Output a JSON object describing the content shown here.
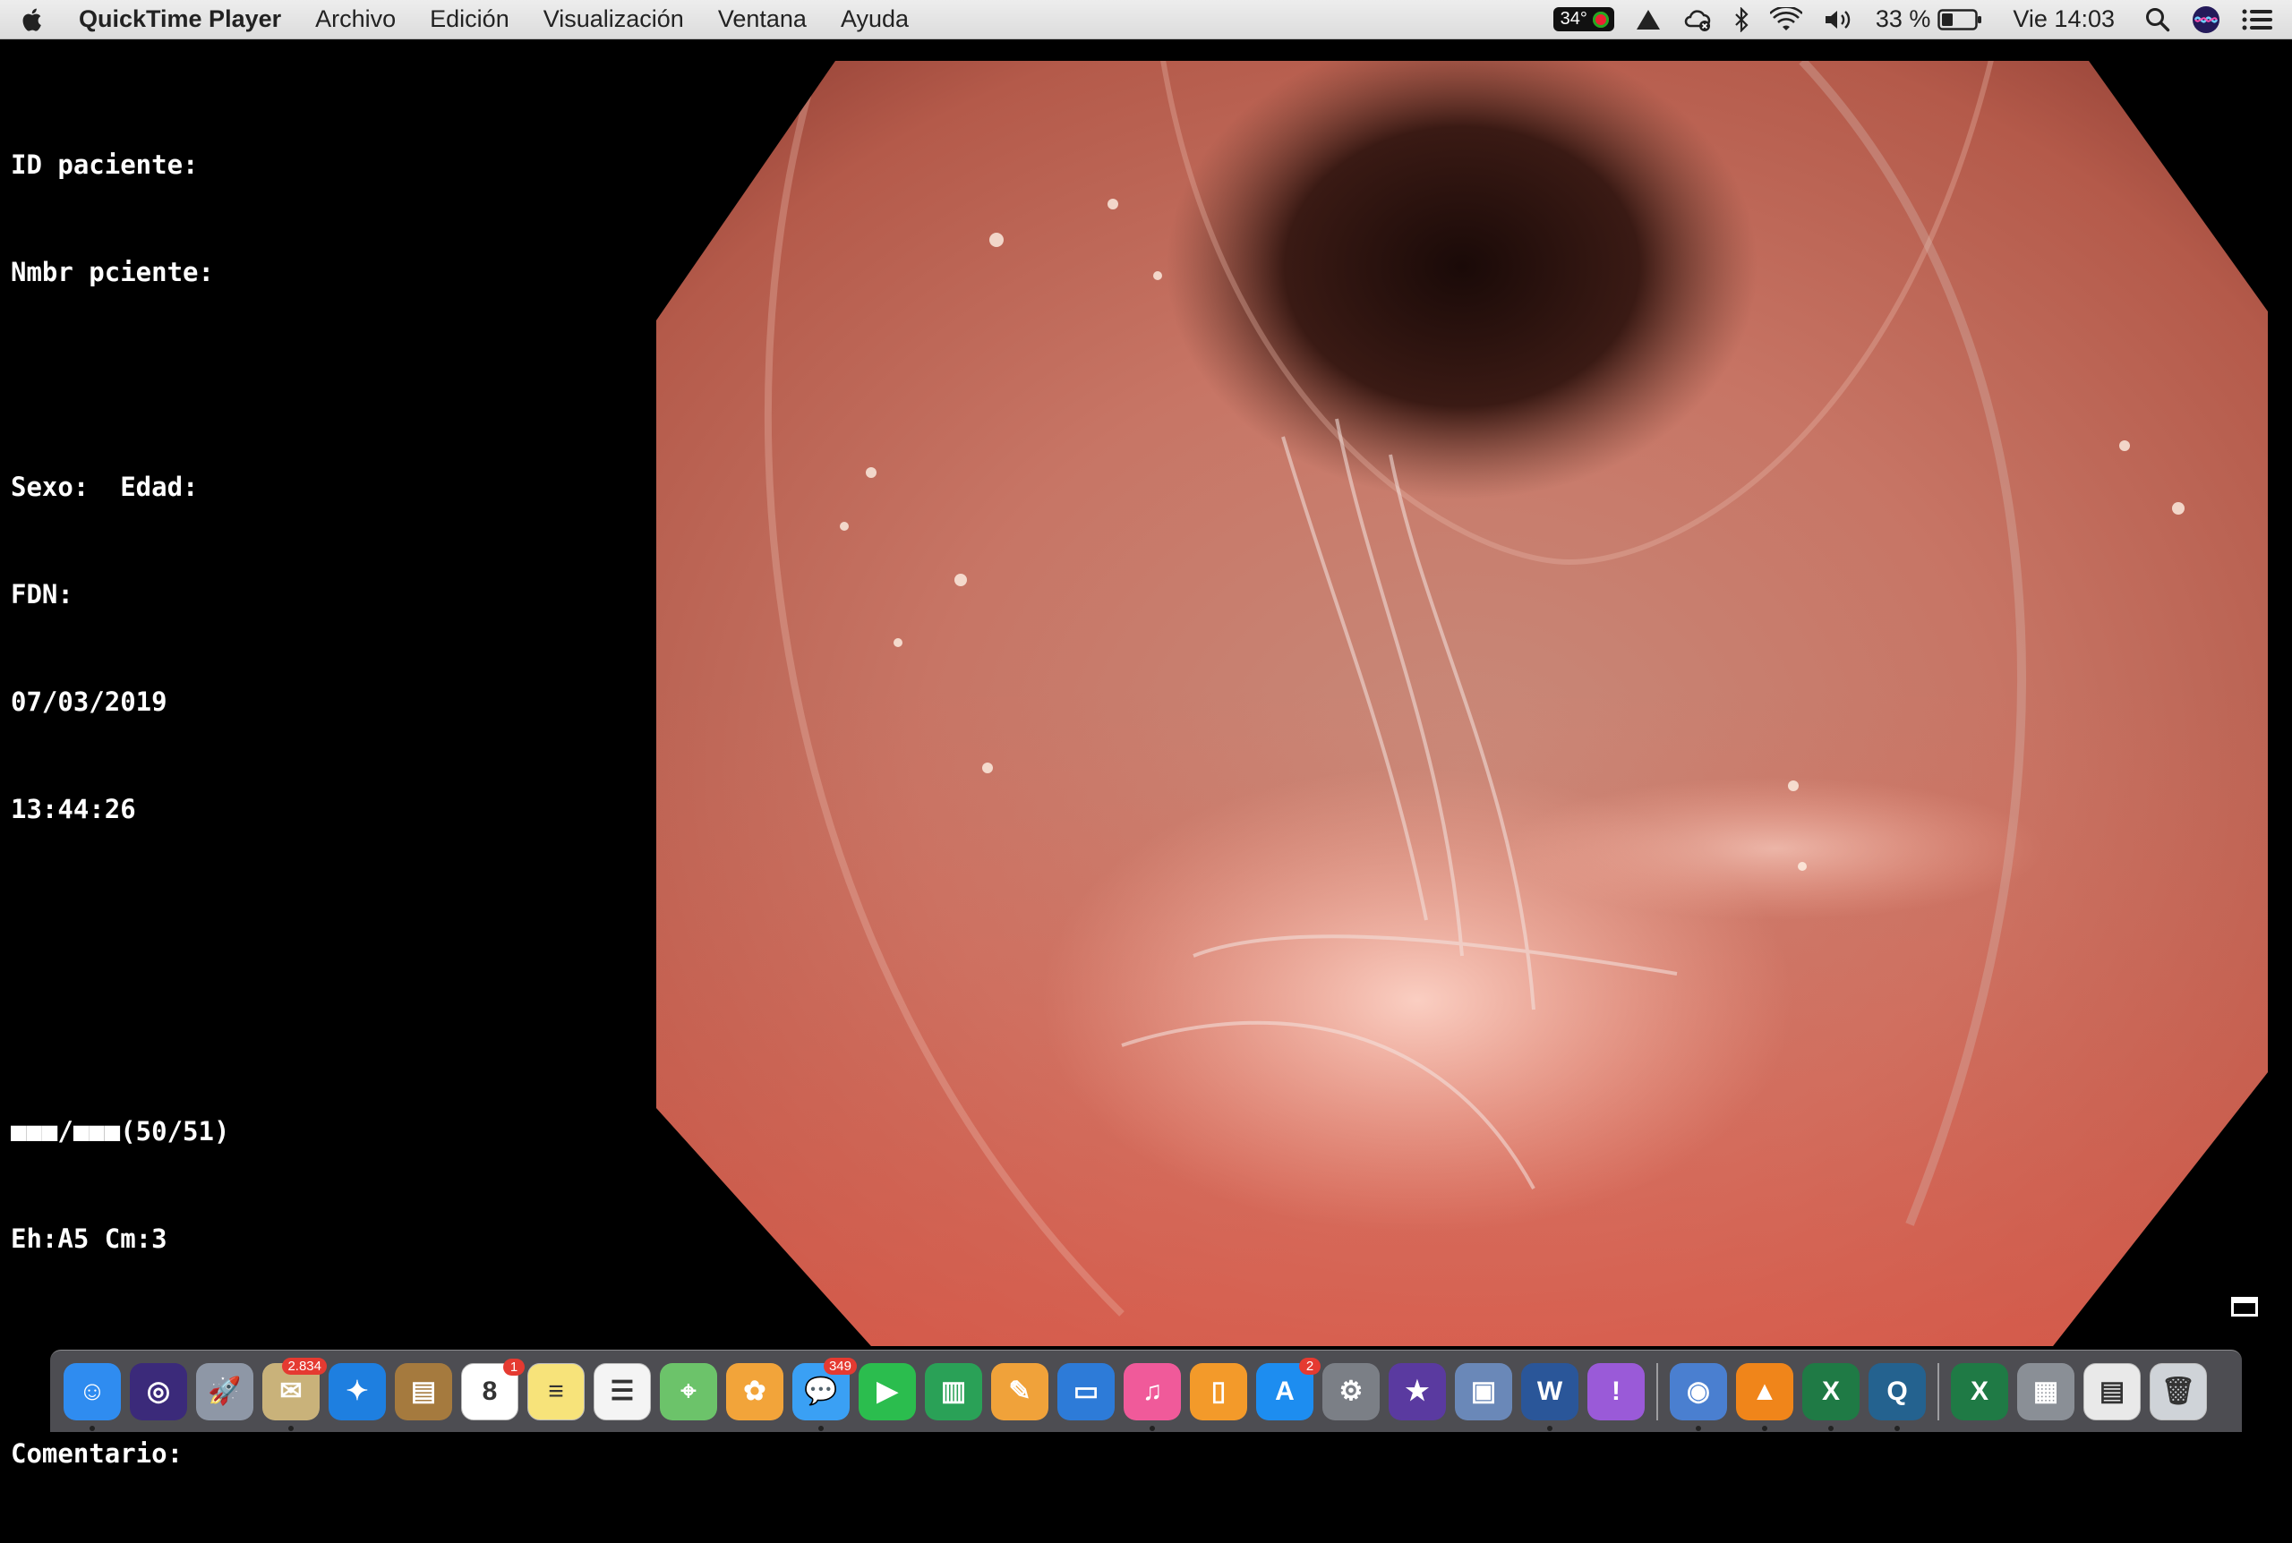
{
  "menubar": {
    "apple_icon": "apple-icon",
    "app_name": "QuickTime Player",
    "menus": [
      "Archivo",
      "Edición",
      "Visualización",
      "Ventana",
      "Ayuda"
    ],
    "status": {
      "temperature": "34°",
      "battery_percent": "33 %",
      "clock": "Vie 14:03"
    }
  },
  "overlay": {
    "lines": [
      "ID paciente:",
      "Nmbr pciente:",
      "",
      "Sexo:  Edad:",
      "FDN:",
      "07/03/2019",
      "13:44:26",
      "",
      "",
      "■■■/■■■(50/51)",
      "Eh:A5 Cm:3",
      "",
      "Comentario:"
    ]
  },
  "video": {
    "content": "endoscopy-frame"
  },
  "dock": {
    "apps": [
      {
        "name": "finder",
        "color": "#2f8cf0",
        "glyph": "☺",
        "running": true
      },
      {
        "name": "siri",
        "color": "#3b2a7a",
        "glyph": "◎",
        "running": false
      },
      {
        "name": "launchpad",
        "color": "#8e97a6",
        "glyph": "🚀",
        "running": false
      },
      {
        "name": "mail-eagle",
        "color": "#c9b27a",
        "glyph": "✉",
        "running": true,
        "badge": "2.834"
      },
      {
        "name": "safari",
        "color": "#1e7fe0",
        "glyph": "✦",
        "running": false
      },
      {
        "name": "contacts",
        "color": "#a57a3e",
        "glyph": "▤",
        "running": false
      },
      {
        "name": "calendar",
        "color": "#ffffff",
        "glyph": "8",
        "running": false,
        "badge": "1",
        "dark": true
      },
      {
        "name": "notes",
        "color": "#f7e37a",
        "glyph": "≡",
        "running": false,
        "dark": true
      },
      {
        "name": "reminders",
        "color": "#f4f4f4",
        "glyph": "☰",
        "running": false,
        "dark": true
      },
      {
        "name": "maps",
        "color": "#6cc36a",
        "glyph": "⌖",
        "running": false
      },
      {
        "name": "photos",
        "color": "#f2a43a",
        "glyph": "✿",
        "running": false
      },
      {
        "name": "messages",
        "color": "#3aa0f4",
        "glyph": "💬",
        "running": true,
        "badge": "349"
      },
      {
        "name": "facetime",
        "color": "#2bbd4e",
        "glyph": "▶",
        "running": false
      },
      {
        "name": "numbers",
        "color": "#2aa157",
        "glyph": "▥",
        "running": false
      },
      {
        "name": "pages-doc",
        "color": "#f0a23a",
        "glyph": "✎",
        "running": false
      },
      {
        "name": "keynote",
        "color": "#2d7bd8",
        "glyph": "▭",
        "running": false
      },
      {
        "name": "itunes",
        "color": "#f05a9a",
        "glyph": "♫",
        "running": true
      },
      {
        "name": "books",
        "color": "#f39a2a",
        "glyph": "▯",
        "running": false
      },
      {
        "name": "app-store",
        "color": "#1d8df0",
        "glyph": "A",
        "running": false,
        "badge": "2"
      },
      {
        "name": "system-preferences",
        "color": "#7b7f86",
        "glyph": "⚙",
        "running": false
      },
      {
        "name": "imovie",
        "color": "#5a3aa0",
        "glyph": "★",
        "running": false
      },
      {
        "name": "preview",
        "color": "#6a88b8",
        "glyph": "▣",
        "running": false
      },
      {
        "name": "word",
        "color": "#2a5699",
        "glyph": "W",
        "running": true
      },
      {
        "name": "feedback",
        "color": "#9a5ad8",
        "glyph": "!",
        "running": false
      }
    ],
    "apps_right": [
      {
        "name": "network-globe",
        "color": "#4a7fd0",
        "glyph": "◉",
        "running": true
      },
      {
        "name": "vlc",
        "color": "#f0851a",
        "glyph": "▲",
        "running": true
      },
      {
        "name": "excel",
        "color": "#1f7a45",
        "glyph": "X",
        "running": true
      },
      {
        "name": "quicktime",
        "color": "#24628f",
        "glyph": "Q",
        "running": true
      }
    ],
    "apps_recent": [
      {
        "name": "excel-doc",
        "color": "#1f7a45",
        "glyph": "X",
        "running": false
      },
      {
        "name": "photos-stack",
        "color": "#8a8f96",
        "glyph": "▦",
        "running": false
      },
      {
        "name": "spreadsheet-stack",
        "color": "#e9e9e9",
        "glyph": "▤",
        "running": false,
        "dark": true
      },
      {
        "name": "trash",
        "color": "#cfd3d8",
        "glyph": "🗑",
        "running": false,
        "dark": true
      }
    ]
  }
}
